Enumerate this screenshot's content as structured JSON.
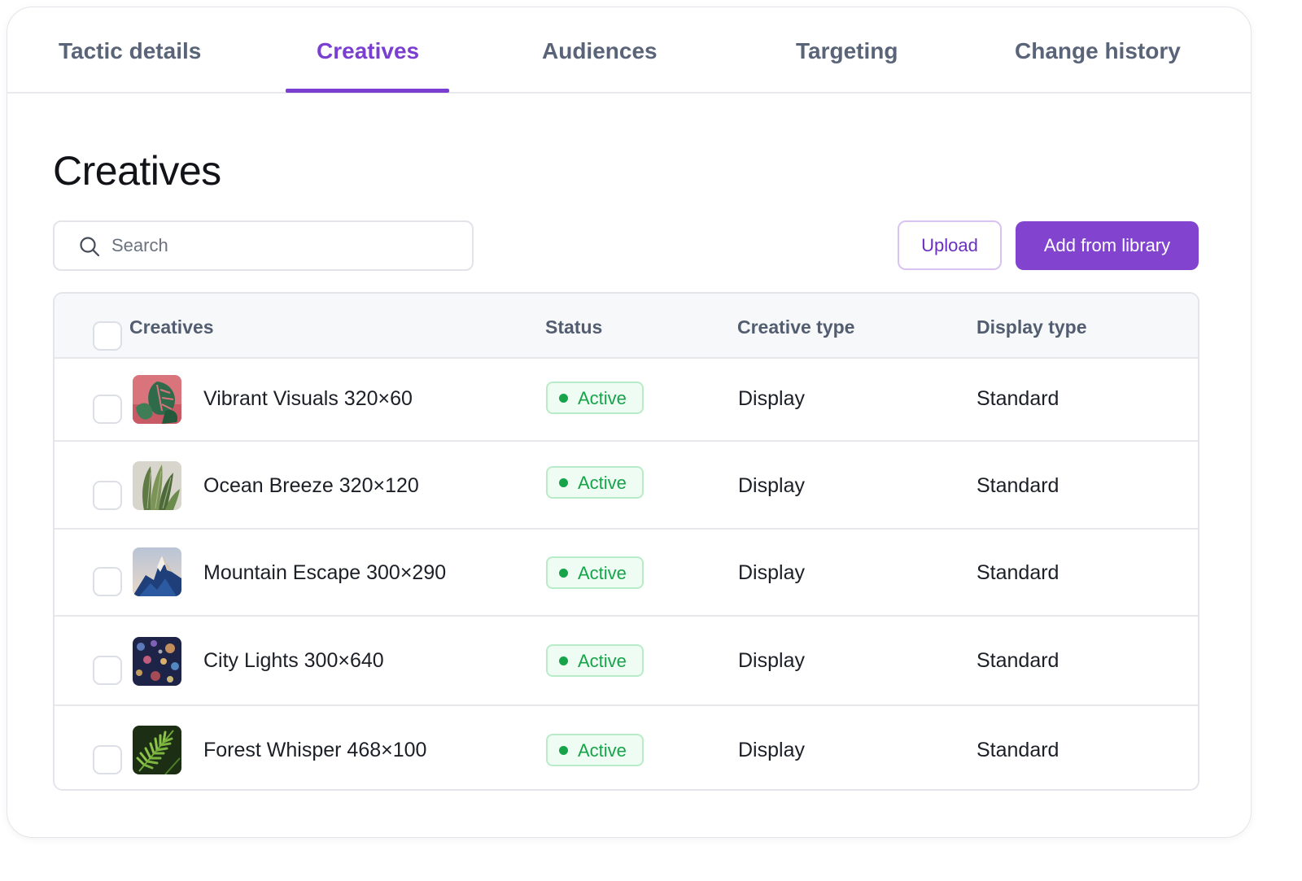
{
  "tabs": [
    {
      "label": "Tactic details",
      "active": false
    },
    {
      "label": "Creatives",
      "active": true
    },
    {
      "label": "Audiences",
      "active": false
    },
    {
      "label": "Targeting",
      "active": false
    },
    {
      "label": "Change history",
      "active": false
    }
  ],
  "page_title": "Creatives",
  "search": {
    "placeholder": "Search",
    "value": ""
  },
  "actions": {
    "upload_label": "Upload",
    "add_library_label": "Add from library"
  },
  "table": {
    "headers": {
      "creatives": "Creatives",
      "status": "Status",
      "creative_type": "Creative type",
      "display_type": "Display type"
    },
    "rows": [
      {
        "name": "Vibrant Visuals 320×60",
        "status": "Active",
        "creative_type": "Display",
        "display_type": "Standard",
        "thumb_icon": "monstera-leaf-image"
      },
      {
        "name": "Ocean Breeze 320×120",
        "status": "Active",
        "creative_type": "Display",
        "display_type": "Standard",
        "thumb_icon": "snake-plant-image"
      },
      {
        "name": "Mountain Escape 300×290",
        "status": "Active",
        "creative_type": "Display",
        "display_type": "Standard",
        "thumb_icon": "mountain-peak-image"
      },
      {
        "name": "City Lights 300×640",
        "status": "Active",
        "creative_type": "Display",
        "display_type": "Standard",
        "thumb_icon": "bokeh-lights-image"
      },
      {
        "name": "Forest Whisper 468×100",
        "status": "Active",
        "creative_type": "Display",
        "display_type": "Standard",
        "thumb_icon": "fern-image"
      }
    ]
  },
  "colors": {
    "accent": "#7a3fd1",
    "primary_button": "#8244cf",
    "status_active": "#16a34a",
    "status_active_bg": "#effcf3"
  }
}
